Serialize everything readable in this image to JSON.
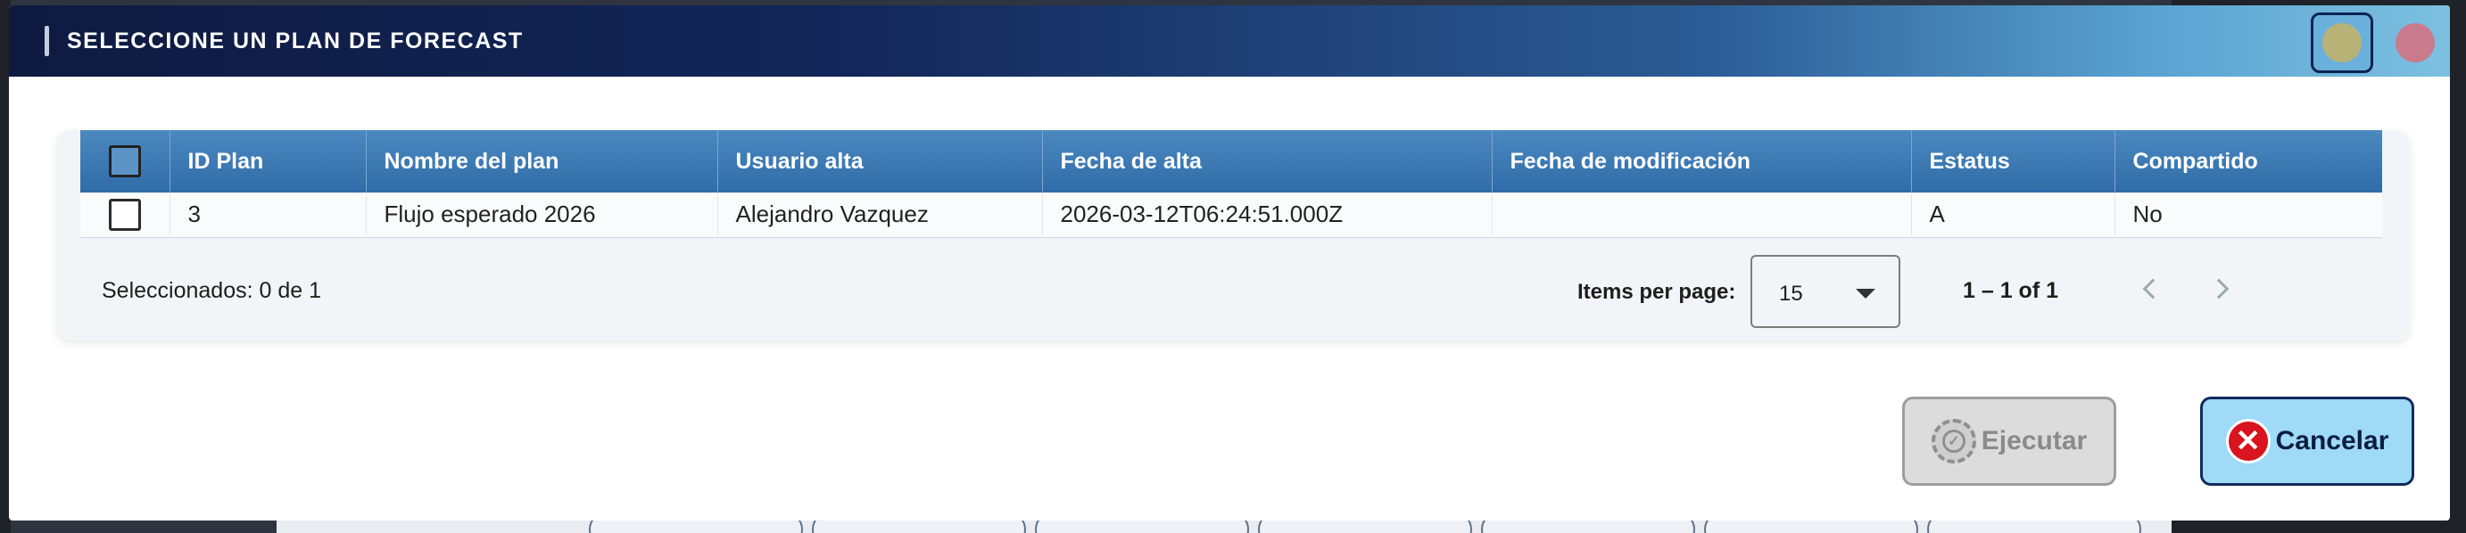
{
  "dialog": {
    "title": "SELECCIONE UN PLAN DE FORECAST"
  },
  "table": {
    "headers": [
      "ID Plan",
      "Nombre del plan",
      "Usuario alta",
      "Fecha de alta",
      "Fecha de modificación",
      "Estatus",
      "Compartido"
    ],
    "rows": [
      {
        "id_plan": "3",
        "nombre": "Flujo esperado 2026",
        "usuario": "Alejandro Vazquez",
        "fecha_alta": "2026-03-12T06:24:51.000Z",
        "fecha_mod": "",
        "estatus": "A",
        "compartido": "No"
      }
    ]
  },
  "footer": {
    "selected_text": "Seleccionados: 0 de 1",
    "items_per_page_label": "Items per page:",
    "items_per_page_value": "15",
    "range_text": "1 – 1 of 1"
  },
  "actions": {
    "ejecutar_label": "Ejecutar",
    "cancelar_label": "Cancelar"
  },
  "colors": {
    "header_gradient_start": "#0e1a40",
    "header_gradient_end": "#7dc0e0",
    "table_header": "#3a78b3",
    "cancel_bg": "#9fdaf6",
    "cancel_icon": "#d8141e",
    "disabled_btn": "#dcdcdc"
  },
  "icons": {
    "ejecutar": "gear-check-icon",
    "cancelar": "close-circle-icon",
    "prev": "chevron-left-icon",
    "next": "chevron-right-icon",
    "select": "caret-down-icon"
  }
}
